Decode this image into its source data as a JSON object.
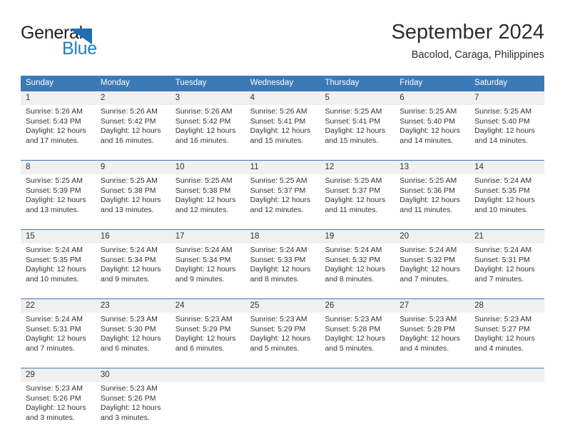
{
  "logo": {
    "word_one": "General",
    "word_two": "Blue",
    "triangle_color": "#1f6fb2",
    "blue_color": "#1f7fc4"
  },
  "header": {
    "title": "September 2024",
    "subtitle": "Bacolod, Caraga, Philippines"
  },
  "theme": {
    "header_band": "#3b79b7",
    "daynum_band": "#f0f0f0",
    "text": "#333333"
  },
  "weekdays": [
    "Sunday",
    "Monday",
    "Tuesday",
    "Wednesday",
    "Thursday",
    "Friday",
    "Saturday"
  ],
  "weeks": [
    {
      "days": [
        {
          "num": "1",
          "sunrise": "Sunrise: 5:26 AM",
          "sunset": "Sunset: 5:43 PM",
          "daylight": "Daylight: 12 hours and 17 minutes."
        },
        {
          "num": "2",
          "sunrise": "Sunrise: 5:26 AM",
          "sunset": "Sunset: 5:42 PM",
          "daylight": "Daylight: 12 hours and 16 minutes."
        },
        {
          "num": "3",
          "sunrise": "Sunrise: 5:26 AM",
          "sunset": "Sunset: 5:42 PM",
          "daylight": "Daylight: 12 hours and 16 minutes."
        },
        {
          "num": "4",
          "sunrise": "Sunrise: 5:26 AM",
          "sunset": "Sunset: 5:41 PM",
          "daylight": "Daylight: 12 hours and 15 minutes."
        },
        {
          "num": "5",
          "sunrise": "Sunrise: 5:25 AM",
          "sunset": "Sunset: 5:41 PM",
          "daylight": "Daylight: 12 hours and 15 minutes."
        },
        {
          "num": "6",
          "sunrise": "Sunrise: 5:25 AM",
          "sunset": "Sunset: 5:40 PM",
          "daylight": "Daylight: 12 hours and 14 minutes."
        },
        {
          "num": "7",
          "sunrise": "Sunrise: 5:25 AM",
          "sunset": "Sunset: 5:40 PM",
          "daylight": "Daylight: 12 hours and 14 minutes."
        }
      ]
    },
    {
      "days": [
        {
          "num": "8",
          "sunrise": "Sunrise: 5:25 AM",
          "sunset": "Sunset: 5:39 PM",
          "daylight": "Daylight: 12 hours and 13 minutes."
        },
        {
          "num": "9",
          "sunrise": "Sunrise: 5:25 AM",
          "sunset": "Sunset: 5:38 PM",
          "daylight": "Daylight: 12 hours and 13 minutes."
        },
        {
          "num": "10",
          "sunrise": "Sunrise: 5:25 AM",
          "sunset": "Sunset: 5:38 PM",
          "daylight": "Daylight: 12 hours and 12 minutes."
        },
        {
          "num": "11",
          "sunrise": "Sunrise: 5:25 AM",
          "sunset": "Sunset: 5:37 PM",
          "daylight": "Daylight: 12 hours and 12 minutes."
        },
        {
          "num": "12",
          "sunrise": "Sunrise: 5:25 AM",
          "sunset": "Sunset: 5:37 PM",
          "daylight": "Daylight: 12 hours and 11 minutes."
        },
        {
          "num": "13",
          "sunrise": "Sunrise: 5:25 AM",
          "sunset": "Sunset: 5:36 PM",
          "daylight": "Daylight: 12 hours and 11 minutes."
        },
        {
          "num": "14",
          "sunrise": "Sunrise: 5:24 AM",
          "sunset": "Sunset: 5:35 PM",
          "daylight": "Daylight: 12 hours and 10 minutes."
        }
      ]
    },
    {
      "days": [
        {
          "num": "15",
          "sunrise": "Sunrise: 5:24 AM",
          "sunset": "Sunset: 5:35 PM",
          "daylight": "Daylight: 12 hours and 10 minutes."
        },
        {
          "num": "16",
          "sunrise": "Sunrise: 5:24 AM",
          "sunset": "Sunset: 5:34 PM",
          "daylight": "Daylight: 12 hours and 9 minutes."
        },
        {
          "num": "17",
          "sunrise": "Sunrise: 5:24 AM",
          "sunset": "Sunset: 5:34 PM",
          "daylight": "Daylight: 12 hours and 9 minutes."
        },
        {
          "num": "18",
          "sunrise": "Sunrise: 5:24 AM",
          "sunset": "Sunset: 5:33 PM",
          "daylight": "Daylight: 12 hours and 8 minutes."
        },
        {
          "num": "19",
          "sunrise": "Sunrise: 5:24 AM",
          "sunset": "Sunset: 5:32 PM",
          "daylight": "Daylight: 12 hours and 8 minutes."
        },
        {
          "num": "20",
          "sunrise": "Sunrise: 5:24 AM",
          "sunset": "Sunset: 5:32 PM",
          "daylight": "Daylight: 12 hours and 7 minutes."
        },
        {
          "num": "21",
          "sunrise": "Sunrise: 5:24 AM",
          "sunset": "Sunset: 5:31 PM",
          "daylight": "Daylight: 12 hours and 7 minutes."
        }
      ]
    },
    {
      "days": [
        {
          "num": "22",
          "sunrise": "Sunrise: 5:24 AM",
          "sunset": "Sunset: 5:31 PM",
          "daylight": "Daylight: 12 hours and 7 minutes."
        },
        {
          "num": "23",
          "sunrise": "Sunrise: 5:23 AM",
          "sunset": "Sunset: 5:30 PM",
          "daylight": "Daylight: 12 hours and 6 minutes."
        },
        {
          "num": "24",
          "sunrise": "Sunrise: 5:23 AM",
          "sunset": "Sunset: 5:29 PM",
          "daylight": "Daylight: 12 hours and 6 minutes."
        },
        {
          "num": "25",
          "sunrise": "Sunrise: 5:23 AM",
          "sunset": "Sunset: 5:29 PM",
          "daylight": "Daylight: 12 hours and 5 minutes."
        },
        {
          "num": "26",
          "sunrise": "Sunrise: 5:23 AM",
          "sunset": "Sunset: 5:28 PM",
          "daylight": "Daylight: 12 hours and 5 minutes."
        },
        {
          "num": "27",
          "sunrise": "Sunrise: 5:23 AM",
          "sunset": "Sunset: 5:28 PM",
          "daylight": "Daylight: 12 hours and 4 minutes."
        },
        {
          "num": "28",
          "sunrise": "Sunrise: 5:23 AM",
          "sunset": "Sunset: 5:27 PM",
          "daylight": "Daylight: 12 hours and 4 minutes."
        }
      ]
    },
    {
      "days": [
        {
          "num": "29",
          "sunrise": "Sunrise: 5:23 AM",
          "sunset": "Sunset: 5:26 PM",
          "daylight": "Daylight: 12 hours and 3 minutes."
        },
        {
          "num": "30",
          "sunrise": "Sunrise: 5:23 AM",
          "sunset": "Sunset: 5:26 PM",
          "daylight": "Daylight: 12 hours and 3 minutes."
        },
        {
          "num": "",
          "sunrise": "",
          "sunset": "",
          "daylight": ""
        },
        {
          "num": "",
          "sunrise": "",
          "sunset": "",
          "daylight": ""
        },
        {
          "num": "",
          "sunrise": "",
          "sunset": "",
          "daylight": ""
        },
        {
          "num": "",
          "sunrise": "",
          "sunset": "",
          "daylight": ""
        },
        {
          "num": "",
          "sunrise": "",
          "sunset": "",
          "daylight": ""
        }
      ]
    }
  ]
}
